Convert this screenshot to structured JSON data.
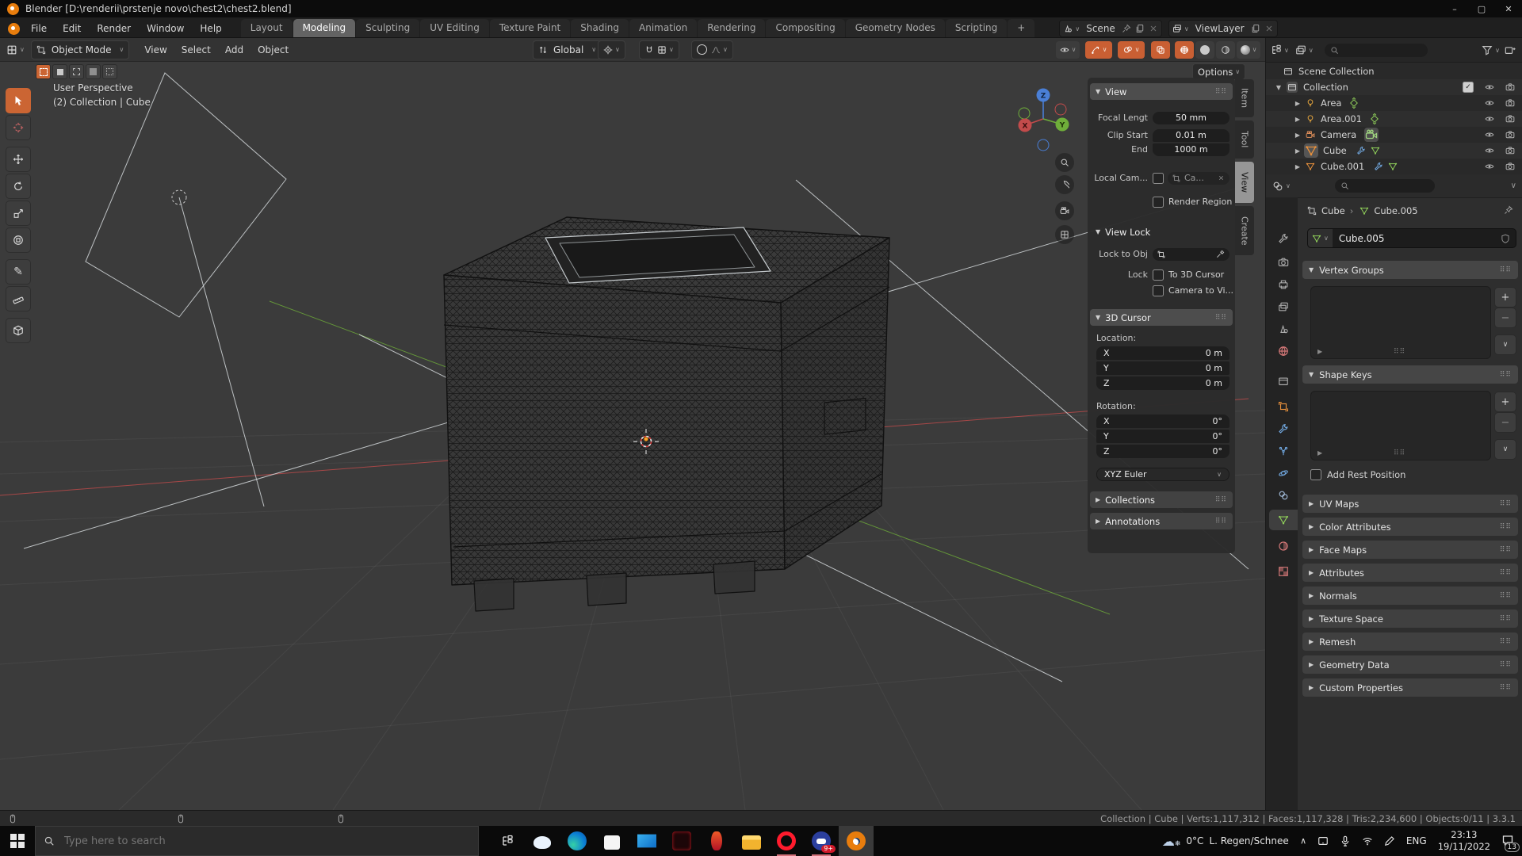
{
  "colors": {
    "accent": "#e8762c",
    "axis_x": "#cb4a4a",
    "axis_y": "#6fae3a",
    "axis_z": "#4a7fd6",
    "active_tool": "#cb6533"
  },
  "titlebar": {
    "title": "Blender [D:\\renderii\\prstenje novo\\chest2\\chest2.blend]",
    "minimize": "–",
    "maximize": "▢",
    "close": "✕"
  },
  "topbar": {
    "menus": [
      "File",
      "Edit",
      "Render",
      "Window",
      "Help"
    ],
    "tabs": [
      "Layout",
      "Modeling",
      "Sculpting",
      "UV Editing",
      "Texture Paint",
      "Shading",
      "Animation",
      "Rendering",
      "Compositing",
      "Geometry Nodes",
      "Scripting"
    ],
    "add_tab": "+",
    "scene_label": "Scene",
    "viewlayer_label": "ViewLayer"
  },
  "vp_header": {
    "mode": "Object Mode",
    "menus": [
      "View",
      "Select",
      "Add",
      "Object"
    ],
    "orientation": "Global",
    "options": "Options"
  },
  "viewport": {
    "perspective": "User Perspective",
    "active_info": "(2) Collection | Cube",
    "axis_x": "X",
    "axis_y": "Y",
    "axis_z": "Z"
  },
  "npanel": {
    "tabs": [
      "Item",
      "Tool",
      "View",
      "Create"
    ],
    "view_title": "View",
    "focal_label": "Focal Lengt",
    "focal_value": "50 mm",
    "clip_start_label": "Clip Start",
    "clip_start_value": "0.01 m",
    "end_label": "End",
    "end_value": "1000 m",
    "local_cam_label": "Local Cam...",
    "local_cam_value": "Ca...",
    "render_region_label": "Render Region",
    "view_lock_title": "View Lock",
    "lock_obj_label": "Lock to Obj",
    "lock_label": "Lock",
    "to_3d_cursor": "To 3D Cursor",
    "camera_to_view": "Camera to Vi...",
    "cursor_title": "3D Cursor",
    "location_label": "Location:",
    "rotation_label": "Rotation:",
    "loc_rows": [
      {
        "axis": "X",
        "value": "0 m"
      },
      {
        "axis": "Y",
        "value": "0 m"
      },
      {
        "axis": "Z",
        "value": "0 m"
      }
    ],
    "rot_rows": [
      {
        "axis": "X",
        "value": "0°"
      },
      {
        "axis": "Y",
        "value": "0°"
      },
      {
        "axis": "Z",
        "value": "0°"
      }
    ],
    "euler": "XYZ Euler",
    "collections_title": "Collections",
    "annotations_title": "Annotations"
  },
  "outliner": {
    "scene_collection": "Scene Collection",
    "collection": "Collection",
    "items": [
      {
        "label": "Area"
      },
      {
        "label": "Area.001"
      },
      {
        "label": "Camera"
      },
      {
        "label": "Cube"
      },
      {
        "label": "Cube.001"
      }
    ]
  },
  "properties": {
    "breadcrumb_object": "Cube",
    "breadcrumb_data": "Cube.005",
    "name_value": "Cube.005",
    "vertex_groups": "Vertex Groups",
    "shape_keys": "Shape Keys",
    "add_rest": "Add Rest Position",
    "collapsed": [
      "UV Maps",
      "Color Attributes",
      "Face Maps",
      "Attributes",
      "Normals",
      "Texture Space",
      "Remesh",
      "Geometry Data",
      "Custom Properties"
    ]
  },
  "statusbar": {
    "info": "Collection | Cube | Verts:1,117,312 | Faces:1,117,328 | Tris:2,234,600 | Objects:0/11 | 3.3.1"
  },
  "taskbar": {
    "search_placeholder": "Type here to search",
    "apps": [
      "task-view",
      "cloud-app",
      "edge-browser",
      "microsoft-store",
      "mail-app",
      "dark-red-app",
      "red-app",
      "file-explorer",
      "opera-browser",
      "game-app",
      "blender"
    ],
    "temp": "0°C",
    "weather_desc": "L. Regen/Schnee",
    "lang": "ENG",
    "time": "23:13",
    "date": "19/11/2022",
    "notif_count": "13"
  }
}
